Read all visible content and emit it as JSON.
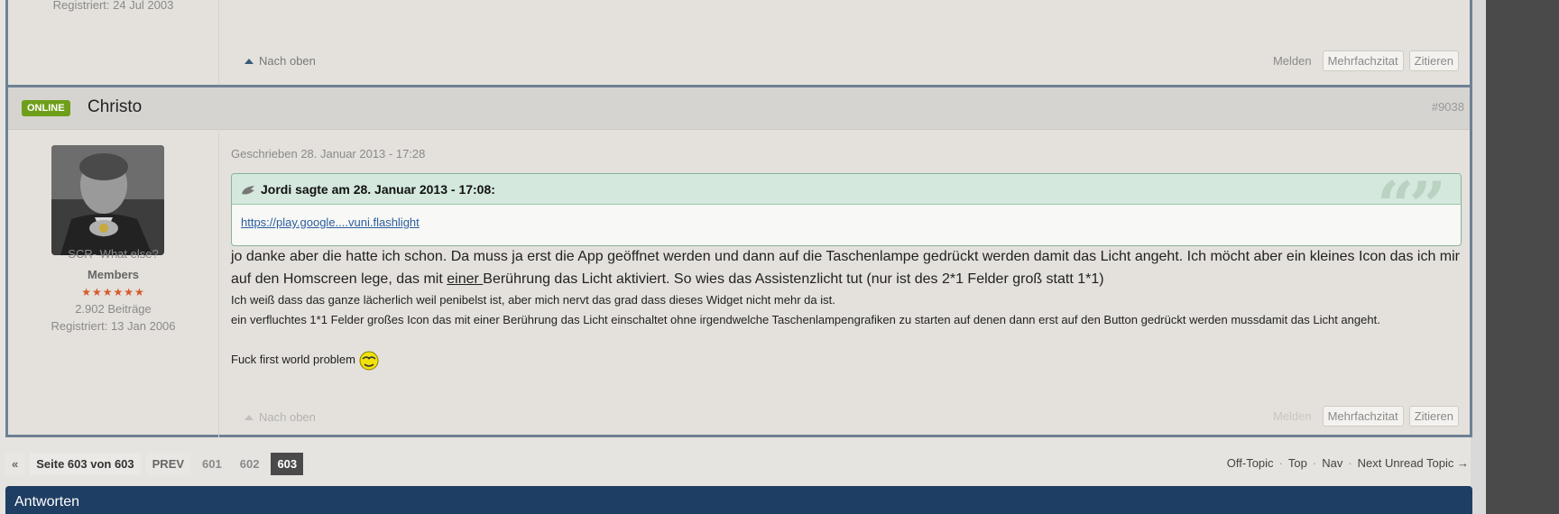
{
  "prev_post": {
    "registered": "Registriert: 24 Jul 2003",
    "back_to_top": "Nach oben",
    "report": "Melden",
    "multiquote": "Mehrfachzitat",
    "quote": "Zitieren"
  },
  "post": {
    "online_badge": "ONLINE",
    "author": "Christo",
    "post_number": "#9038",
    "user": {
      "signature": "SCR- What else?",
      "rank": "Members",
      "stars": "★★★★★★",
      "posts": "2.902 Beiträge",
      "registered": "Registriert: 13 Jan 2006"
    },
    "written": "Geschrieben 28. Januar 2013 - 17:28",
    "quote": {
      "header": "Jordi sagte am 28. Januar 2013 - 17:08:",
      "link": "https://play.google....vuni.flashlight"
    },
    "body_large_1": "jo danke aber die hatte ich schon. Da muss ja erst die App geöffnet werden und dann auf die Taschenlampe gedrückt werden damit das Licht angeht. Ich möcht aber ein kleines Icon das ich mir auf den Homscreen lege, das mit ",
    "body_large_underlined": "einer ",
    "body_large_2": "Berührung das Licht aktiviert. So wies das Assistenzlicht tut (nur ist des 2*1 Felder groß statt 1*1)",
    "body_small_1": "Ich weiß dass das ganze lächerlich weil penibelst ist, aber mich nervt das grad dass dieses Widget nicht mehr da ist.",
    "body_small_2": "ein verfluchtes 1*1 Felder großes Icon das mit einer Berührung das Licht einschaltet ohne irgendwelche Taschenlampengrafiken zu starten auf denen dann erst auf den Button gedrückt werden mussdamit das Licht angeht.",
    "body_small_3": "Fuck first world problem",
    "back_to_top": "Nach oben",
    "report": "Melden",
    "multiquote": "Mehrfachzitat",
    "quote_btn": "Zitieren"
  },
  "pagination": {
    "first": "«",
    "info": "Seite 603 von 603",
    "prev": "PREV",
    "pages": [
      "601",
      "602",
      "603"
    ]
  },
  "topic_nav": {
    "off_topic": "Off-Topic",
    "top": "Top",
    "nav": "Nav",
    "next_unread": "Next Unread Topic →"
  },
  "answer_bar": "Antworten",
  "colors": {
    "online": "#6f9f1a",
    "quote_border": "#86b496",
    "answer_bar": "#1f3e63",
    "stars": "#d65a2a"
  }
}
